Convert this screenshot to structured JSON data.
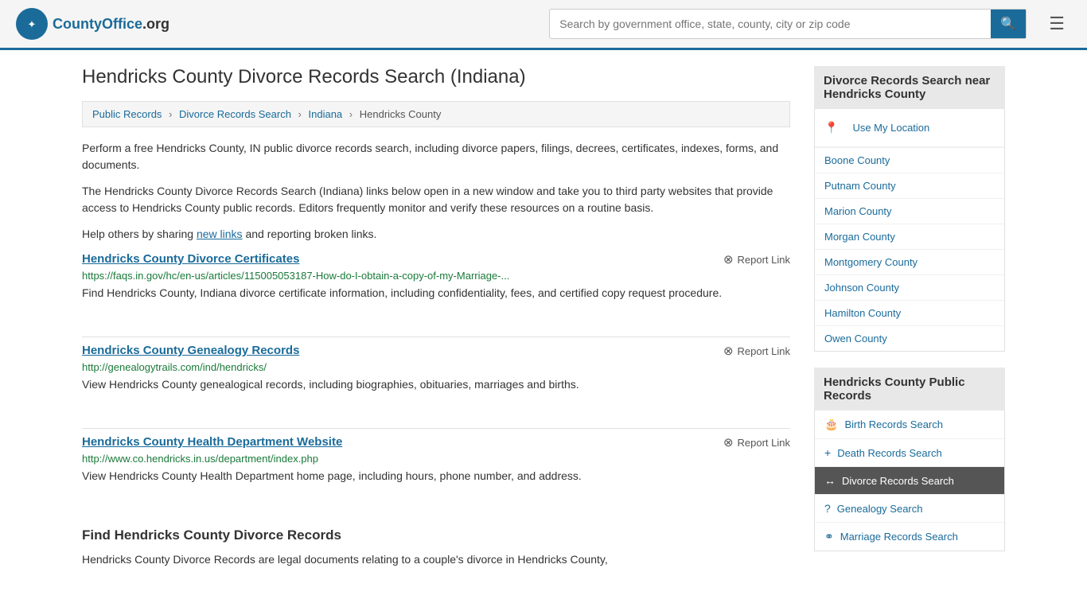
{
  "header": {
    "logo_text": "CountyOffice",
    "logo_suffix": ".org",
    "search_placeholder": "Search by government office, state, county, city or zip code"
  },
  "page": {
    "title": "Hendricks County Divorce Records Search (Indiana)",
    "breadcrumb": {
      "items": [
        "Public Records",
        "Divorce Records Search",
        "Indiana",
        "Hendricks County"
      ]
    },
    "description1": "Perform a free Hendricks County, IN public divorce records search, including divorce papers, filings, decrees, certificates, indexes, forms, and documents.",
    "description2": "The Hendricks County Divorce Records Search (Indiana) links below open in a new window and take you to third party websites that provide access to Hendricks County public records. Editors frequently monitor and verify these resources on a routine basis.",
    "description3_pre": "Help others by sharing ",
    "description3_link": "new links",
    "description3_post": " and reporting broken links.",
    "records": [
      {
        "title": "Hendricks County Divorce Certificates",
        "url": "https://faqs.in.gov/hc/en-us/articles/115005053187-How-do-I-obtain-a-copy-of-my-Marriage-...",
        "desc": "Find Hendricks County, Indiana divorce certificate information, including confidentiality, fees, and certified copy request procedure.",
        "report_label": "Report Link"
      },
      {
        "title": "Hendricks County Genealogy Records",
        "url": "http://genealogytrails.com/ind/hendricks/",
        "desc": "View Hendricks County genealogical records, including biographies, obituaries, marriages and births.",
        "report_label": "Report Link"
      },
      {
        "title": "Hendricks County Health Department Website",
        "url": "http://www.co.hendricks.in.us/department/index.php",
        "desc": "View Hendricks County Health Department home page, including hours, phone number, and address.",
        "report_label": "Report Link"
      }
    ],
    "section_heading": "Find Hendricks County Divorce Records",
    "bottom_desc": "Hendricks County Divorce Records are legal documents relating to a couple's divorce in Hendricks County,"
  },
  "sidebar": {
    "nearby_title": "Divorce Records Search near Hendricks County",
    "use_location_label": "Use My Location",
    "nearby_counties": [
      "Boone County",
      "Putnam County",
      "Marion County",
      "Morgan County",
      "Montgomery County",
      "Johnson County",
      "Hamilton County",
      "Owen County"
    ],
    "public_records_title": "Hendricks County Public Records",
    "records_links": [
      {
        "icon": "🎂",
        "label": "Birth Records Search",
        "active": false
      },
      {
        "icon": "+",
        "label": "Death Records Search",
        "active": false
      },
      {
        "icon": "↔",
        "label": "Divorce Records Search",
        "active": true
      },
      {
        "icon": "?",
        "label": "Genealogy Search",
        "active": false
      },
      {
        "icon": "⚭",
        "label": "Marriage Records Search",
        "active": false
      }
    ]
  }
}
